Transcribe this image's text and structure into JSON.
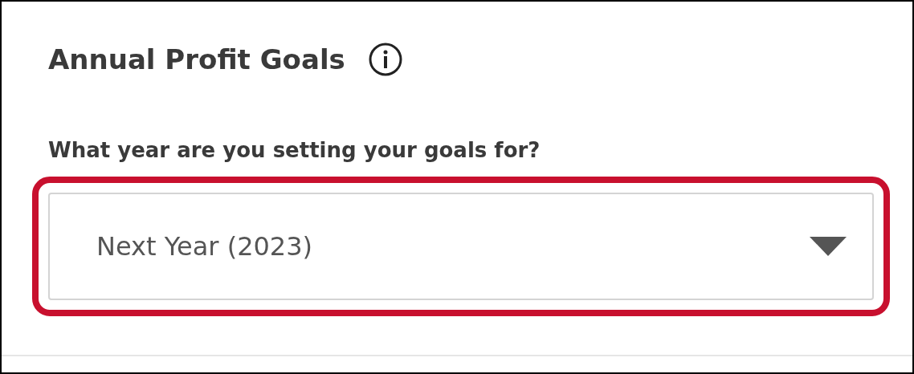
{
  "card": {
    "title": "Annual Profit Goals"
  },
  "question": {
    "label": "What year are you setting your goals for?"
  },
  "dropdown": {
    "value": "Next Year (2023)",
    "highlighted": true
  }
}
